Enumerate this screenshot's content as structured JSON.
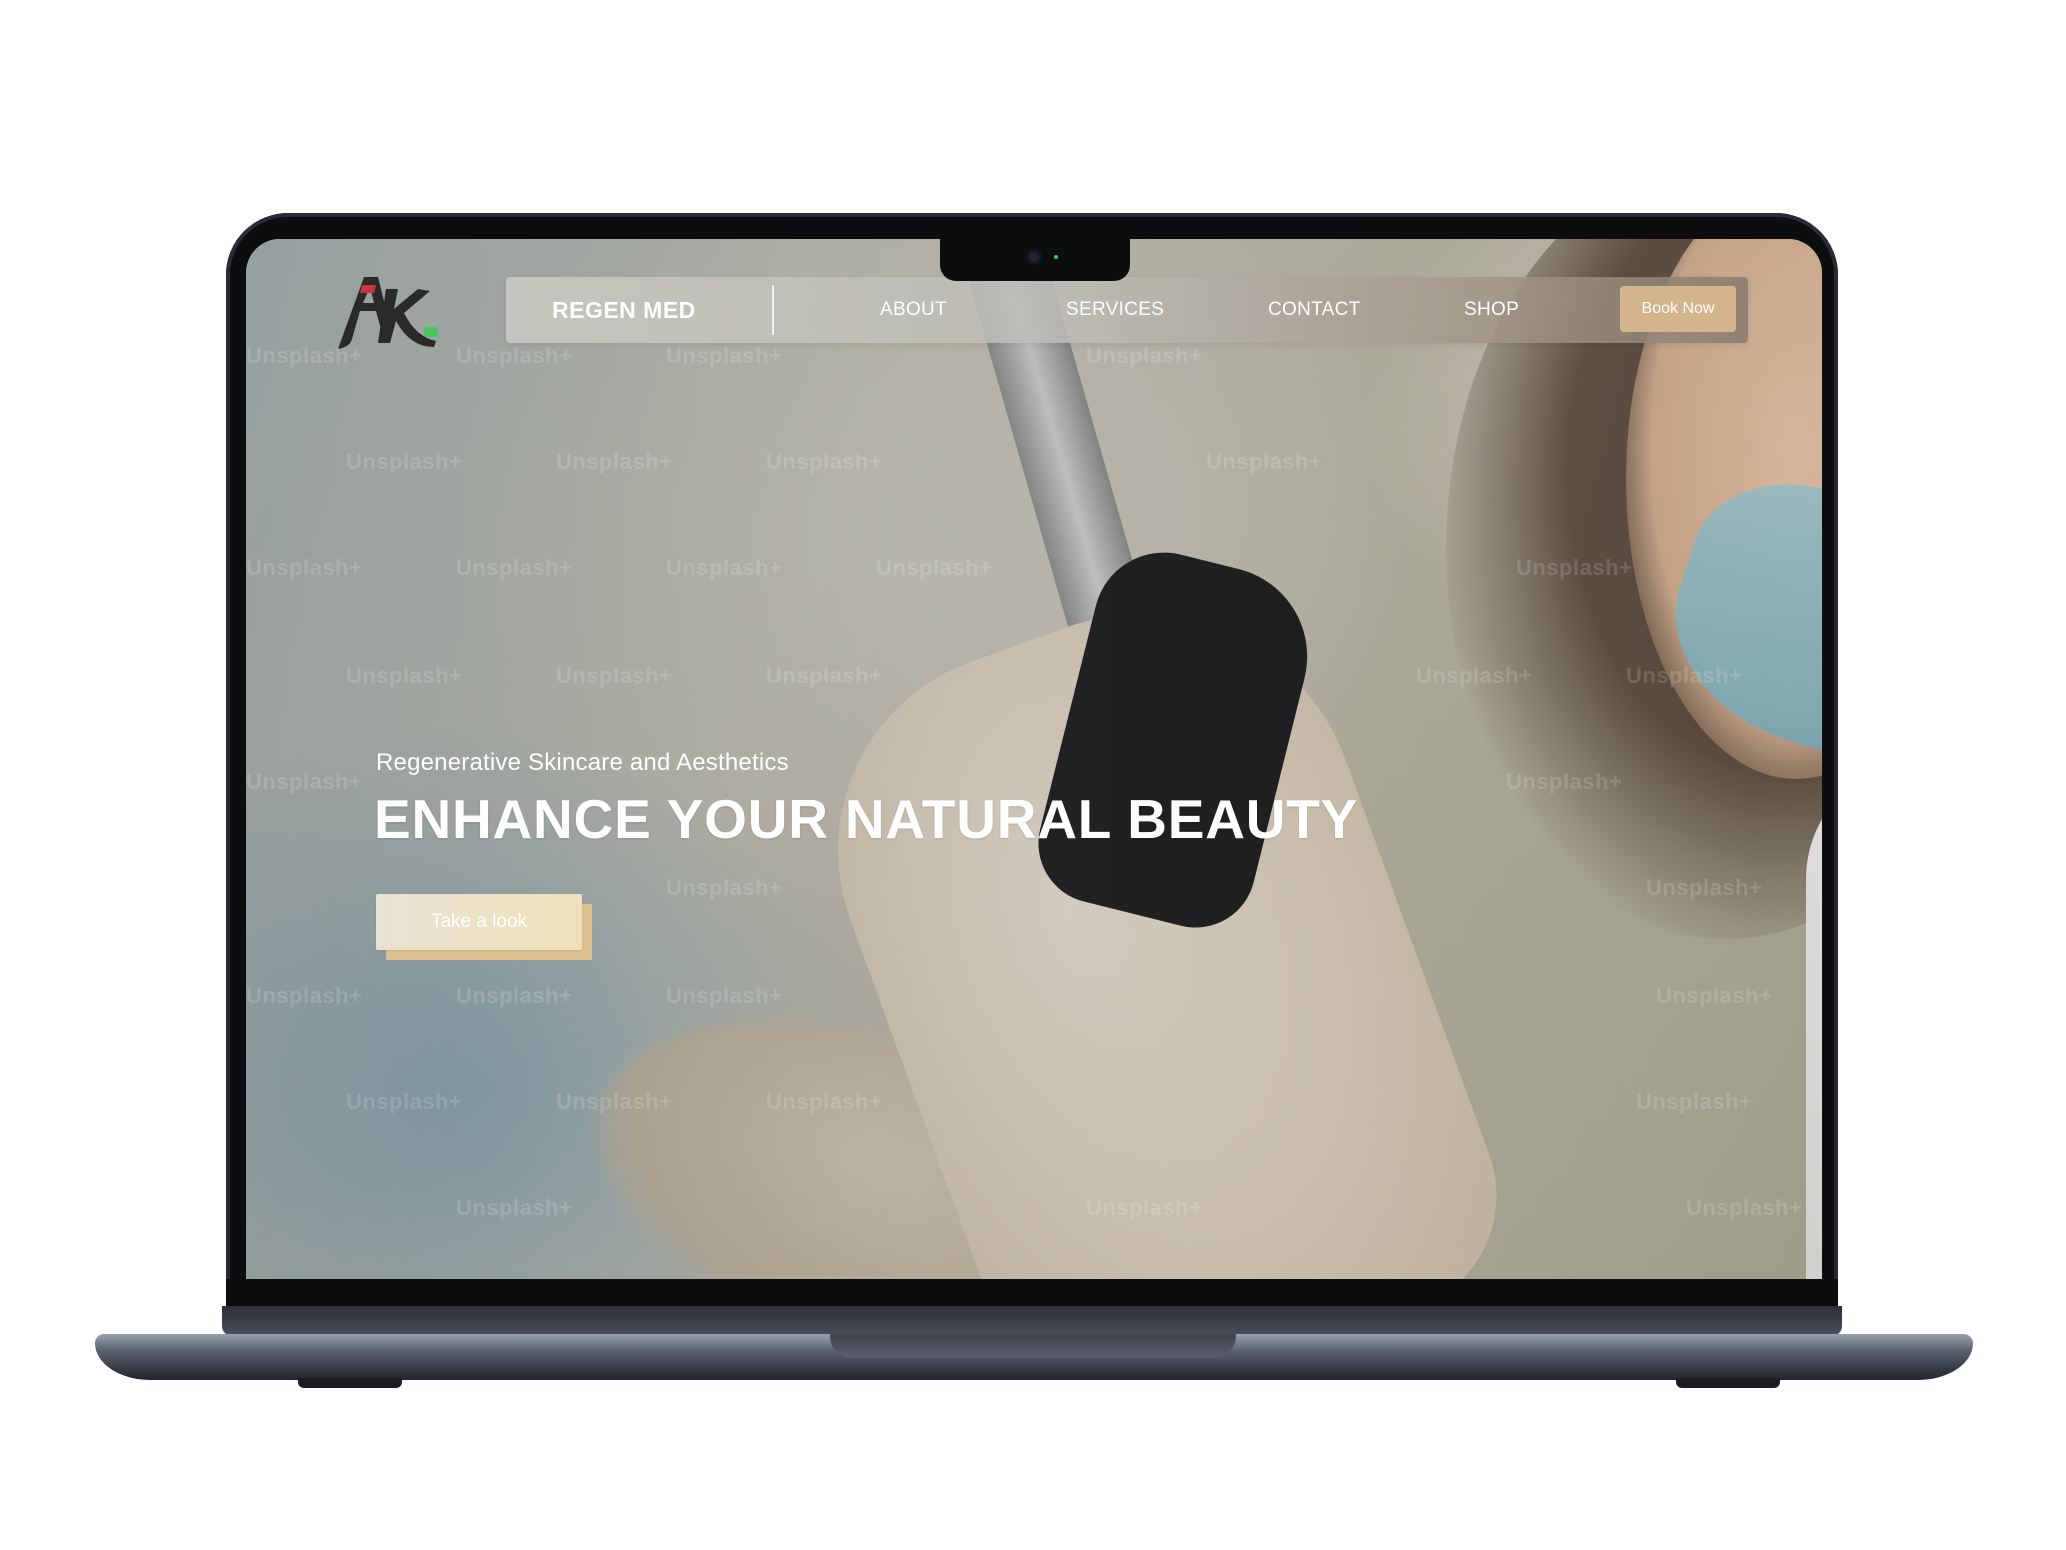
{
  "nav": {
    "brand": "REGEN MED",
    "links": [
      "ABOUT",
      "SERVICES",
      "CONTACT",
      "SHOP"
    ],
    "cta_label": "Book Now"
  },
  "hero": {
    "subtitle": "Regenerative Skincare and Aesthetics",
    "headline": "ENHANCE YOUR NATURAL BEAUTY",
    "button_label": "Take a look"
  },
  "watermark_text": "Unsplash+",
  "colors": {
    "accent": "#d4b48b",
    "cta_gradient_start": "#e8e3d2",
    "cta_gradient_end": "#efe1bb",
    "cta_shadow": "#dcc08f",
    "laptop_frame": "#0c0d0f",
    "laptop_base": "#5c6370",
    "logo_red": "#c8343a",
    "logo_dark": "#2a2a2a",
    "logo_green": "#2fd14f"
  },
  "icons": {
    "logo": "ak-monogram-logo"
  }
}
